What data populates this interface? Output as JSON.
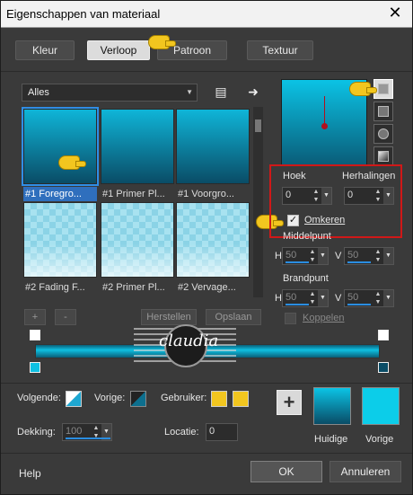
{
  "window": {
    "title": "Eigenschappen van materiaal"
  },
  "tabs": [
    {
      "label": "Kleur"
    },
    {
      "label": "Verloop",
      "active": true
    },
    {
      "label": "Patroon"
    },
    {
      "label": "Textuur"
    }
  ],
  "gradient_browser": {
    "category": "Alles",
    "items": [
      {
        "label": "#1 Foregro...",
        "selected": true,
        "style": "gradient"
      },
      {
        "label": "#1 Primer Pl...",
        "style": "gradient"
      },
      {
        "label": "#1 Voorgro...",
        "style": "gradient"
      },
      {
        "label": "#2 Fading F...",
        "style": "fade"
      },
      {
        "label": "#2 Primer Pl...",
        "style": "fade"
      },
      {
        "label": "#2 Vervage...",
        "style": "fade"
      }
    ],
    "add_label": "+",
    "remove_label": "-",
    "restore_label": "Herstellen",
    "save_label": "Opslaan"
  },
  "gradient_settings": {
    "angle_label": "Hoek",
    "angle_value": "0",
    "repeats_label": "Herhalingen",
    "repeats_value": "0",
    "invert_label": "Omkeren",
    "invert_checked": true,
    "center_label": "Middelpunt",
    "center_h_label": "H",
    "center_h_value": "50",
    "center_v_label": "V",
    "center_v_value": "50",
    "focal_label": "Brandpunt",
    "focal_h_label": "H",
    "focal_h_value": "50",
    "focal_v_label": "V",
    "focal_v_value": "50",
    "link_label": "Koppelen",
    "link_checked": false
  },
  "stop_editor": {
    "next_label": "Volgende:",
    "prev_label": "Vorige:",
    "user_label": "Gebruiker:",
    "opacity_label": "Dekking:",
    "opacity_value": "100",
    "location_label": "Locatie:",
    "location_value": "0"
  },
  "compare": {
    "current_label": "Huidige",
    "previous_label": "Vorige"
  },
  "footer": {
    "help_label": "Help",
    "ok_label": "OK",
    "cancel_label": "Annuleren"
  },
  "watermark": {
    "text": "claudia"
  },
  "colors": {
    "accent_blue": "#2f8ee6",
    "highlight_red": "#d01818",
    "gradient_light": "#0fc6e8",
    "gradient_dark": "#0a4c66",
    "user_yellow": "#f2c61f"
  },
  "icons": {
    "browser_menu": "menu-book-icon",
    "browser_arrow": "arrow-right-icon",
    "pointer_hand": "pointing-hand-icon",
    "close": "close-icon"
  }
}
